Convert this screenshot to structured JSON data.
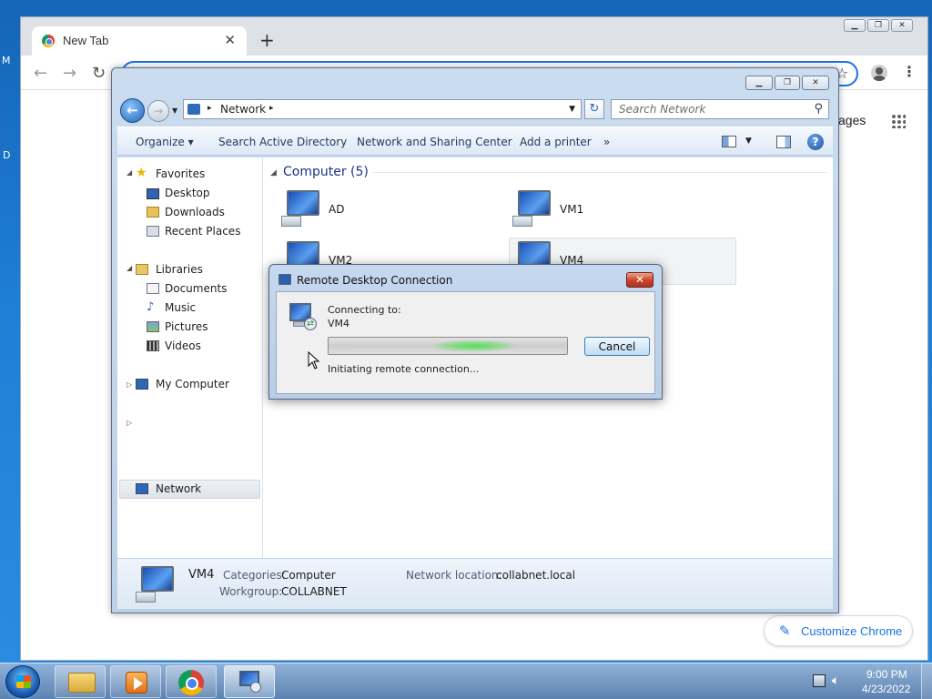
{
  "desktop": {
    "edge_letters": [
      "M",
      "D"
    ]
  },
  "chrome": {
    "tab_title": "New Tab",
    "tab_close": "✕",
    "new_tab": "+",
    "images_link": "ages",
    "customize_label": "Customize Chrome"
  },
  "explorer": {
    "address_crumb": "Network",
    "search_placeholder": "Search Network",
    "commands": [
      "Organize ▾",
      "Search Active Directory",
      "Network and Sharing Center",
      "Add a printer",
      "»"
    ],
    "nav": {
      "favorites": "Favorites",
      "desktop": "Desktop",
      "downloads": "Downloads",
      "recent_places": "Recent Places",
      "libraries": "Libraries",
      "documents": "Documents",
      "music": "Music",
      "pictures": "Pictures",
      "videos": "Videos",
      "my_computer": "My Computer",
      "network": "Network"
    },
    "group_header": "Computer (5)",
    "computers": [
      "AD",
      "VM1",
      "VM2",
      "VM4"
    ],
    "details": {
      "name": "VM4",
      "categories_key": "Categories:",
      "categories_val": "Computer",
      "network_location_key": "Network location:",
      "network_location_val": "collabnet.local",
      "workgroup_key": "Workgroup:",
      "workgroup_val": "COLLABNET"
    }
  },
  "rdp_dialog": {
    "title": "Remote Desktop Connection",
    "close": "✕",
    "connecting_label": "Connecting to:",
    "target": "VM4",
    "cancel_label": "Cancel",
    "status": "Initiating remote connection..."
  },
  "taskbar": {
    "time": "9:00 PM",
    "date": "4/23/2022"
  },
  "colors": {
    "chrome_accent": "#1a73e8",
    "explorer_link": "#1e3287",
    "progress_glow": "#54e054",
    "close_red": "#c7432a"
  }
}
